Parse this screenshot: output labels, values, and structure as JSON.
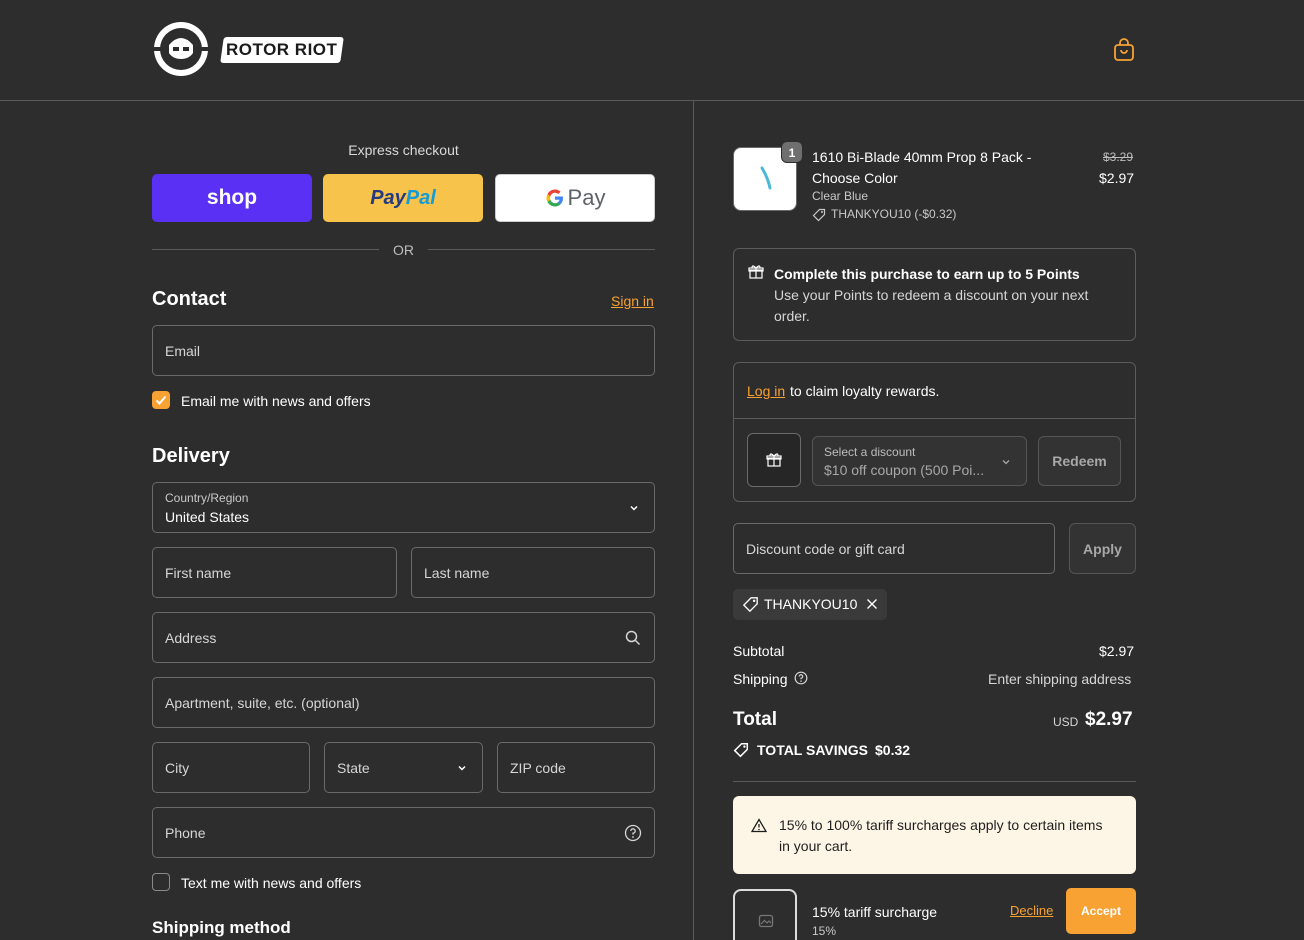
{
  "brand": {
    "name": "ROTOR RIOT"
  },
  "colors": {
    "accent": "#f8a233",
    "background": "#2d2d2d",
    "shop_pay": "#5a31f4",
    "paypal": "#f8c34a",
    "notice_bg": "#fdf6e7"
  },
  "express": {
    "title": "Express checkout",
    "shop_label": "shop",
    "paypal_label_a": "Pay",
    "paypal_label_b": "Pal",
    "gpay_label_g": "G",
    "gpay_label_pay": "Pay",
    "or": "OR"
  },
  "contact": {
    "title": "Contact",
    "sign_in": "Sign in",
    "email_placeholder": "Email",
    "email_optin_label": "Email me with news and offers",
    "email_optin_checked": true
  },
  "delivery": {
    "title": "Delivery",
    "country_label": "Country/Region",
    "country_value": "United States",
    "first_name": "First name",
    "last_name": "Last name",
    "address": "Address",
    "apartment": "Apartment, suite, etc. (optional)",
    "city": "City",
    "state": "State",
    "zip": "ZIP code",
    "phone": "Phone",
    "sms_optin_label": "Text me with news and offers",
    "sms_optin_checked": false
  },
  "shipping_method": {
    "title": "Shipping method"
  },
  "product": {
    "quantity": "1",
    "title_line1": "1610 Bi-Blade 40mm Prop 8 Pack -",
    "title_line2": "Choose Color",
    "variant": "Clear Blue",
    "discount": "THANKYOU10 (-$0.32)",
    "original_price": "$3.29",
    "price": "$2.97"
  },
  "points": {
    "headline": "Complete this purchase to earn up to 5 Points",
    "body_line1": "Use your Points to redeem a discount on your next",
    "body_line2": "order."
  },
  "loyalty": {
    "log_in": "Log in",
    "claim_text": "to claim loyalty rewards.",
    "select_label": "Select a discount",
    "select_value": "$10 off coupon (500 Poi...",
    "redeem": "Redeem"
  },
  "discount": {
    "placeholder": "Discount code or gift card",
    "apply": "Apply",
    "applied_code": "THANKYOU10"
  },
  "summary": {
    "subtotal_label": "Subtotal",
    "subtotal_value": "$2.97",
    "shipping_label": "Shipping",
    "shipping_value": "Enter shipping address",
    "total_label": "Total",
    "currency": "USD",
    "total_value": "$2.97",
    "savings_label": "TOTAL SAVINGS",
    "savings_value": "$0.32"
  },
  "tariff": {
    "notice_line1": "15% to 100% tariff surcharges apply to certain items",
    "notice_line2": "in your cart.",
    "surcharge_title": "15% tariff surcharge",
    "surcharge_rate": "15%",
    "decline": "Decline",
    "accept": "Accept"
  }
}
